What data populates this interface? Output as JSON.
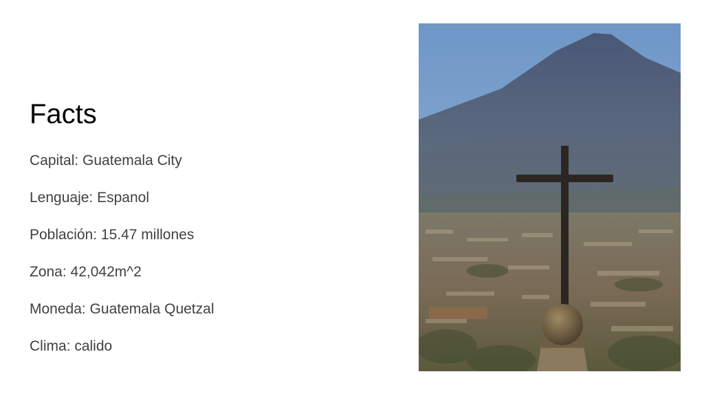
{
  "slide": {
    "title": "Facts",
    "facts": [
      "Capital: Guatemala City",
      "Lenguaje: Espanol",
      "Población: 15.47 millones",
      "Zona: 42,042m^2",
      "Moneda: Guatemala Quetzal",
      "Clima: calido"
    ]
  },
  "photo": {
    "subject": "volcano-with-cross-overlooking-city"
  },
  "colors": {
    "title": "#000000",
    "body_text": "#404040",
    "sky": "#6f9ac9",
    "mountain": "#4f5f7d",
    "cross": "#2b2622"
  }
}
